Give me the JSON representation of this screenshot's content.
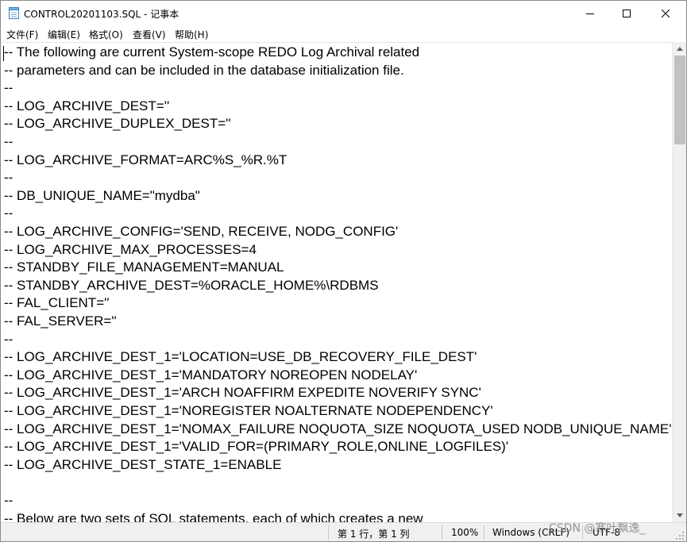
{
  "window": {
    "title": "CONTROL20201103.SQL - 记事本",
    "minimize_icon": "minimize-icon",
    "maximize_icon": "maximize-icon",
    "close_icon": "close-icon"
  },
  "menu": {
    "items": [
      "文件(F)",
      "编辑(E)",
      "格式(O)",
      "查看(V)",
      "帮助(H)"
    ]
  },
  "editor": {
    "lines": [
      "-- The following are current System-scope REDO Log Archival related",
      "-- parameters and can be included in the database initialization file.",
      "--",
      "-- LOG_ARCHIVE_DEST=''",
      "-- LOG_ARCHIVE_DUPLEX_DEST=''",
      "--",
      "-- LOG_ARCHIVE_FORMAT=ARC%S_%R.%T",
      "--",
      "-- DB_UNIQUE_NAME=\"mydba\"",
      "--",
      "-- LOG_ARCHIVE_CONFIG='SEND, RECEIVE, NODG_CONFIG'",
      "-- LOG_ARCHIVE_MAX_PROCESSES=4",
      "-- STANDBY_FILE_MANAGEMENT=MANUAL",
      "-- STANDBY_ARCHIVE_DEST=%ORACLE_HOME%\\RDBMS",
      "-- FAL_CLIENT=''",
      "-- FAL_SERVER=''",
      "--",
      "-- LOG_ARCHIVE_DEST_1='LOCATION=USE_DB_RECOVERY_FILE_DEST'",
      "-- LOG_ARCHIVE_DEST_1='MANDATORY NOREOPEN NODELAY'",
      "-- LOG_ARCHIVE_DEST_1='ARCH NOAFFIRM EXPEDITE NOVERIFY SYNC'",
      "-- LOG_ARCHIVE_DEST_1='NOREGISTER NOALTERNATE NODEPENDENCY'",
      "-- LOG_ARCHIVE_DEST_1='NOMAX_FAILURE NOQUOTA_SIZE NOQUOTA_USED NODB_UNIQUE_NAME'",
      "-- LOG_ARCHIVE_DEST_1='VALID_FOR=(PRIMARY_ROLE,ONLINE_LOGFILES)'",
      "-- LOG_ARCHIVE_DEST_STATE_1=ENABLE",
      "",
      "--",
      "-- Below are two sets of SQL statements, each of which creates a new"
    ]
  },
  "status": {
    "position": "第 1 行，第 1 列",
    "zoom": "100%",
    "line_ending": "Windows (CRLF)",
    "encoding": "UTF-8"
  },
  "watermark": "CSDN @寒叶飘逸_"
}
